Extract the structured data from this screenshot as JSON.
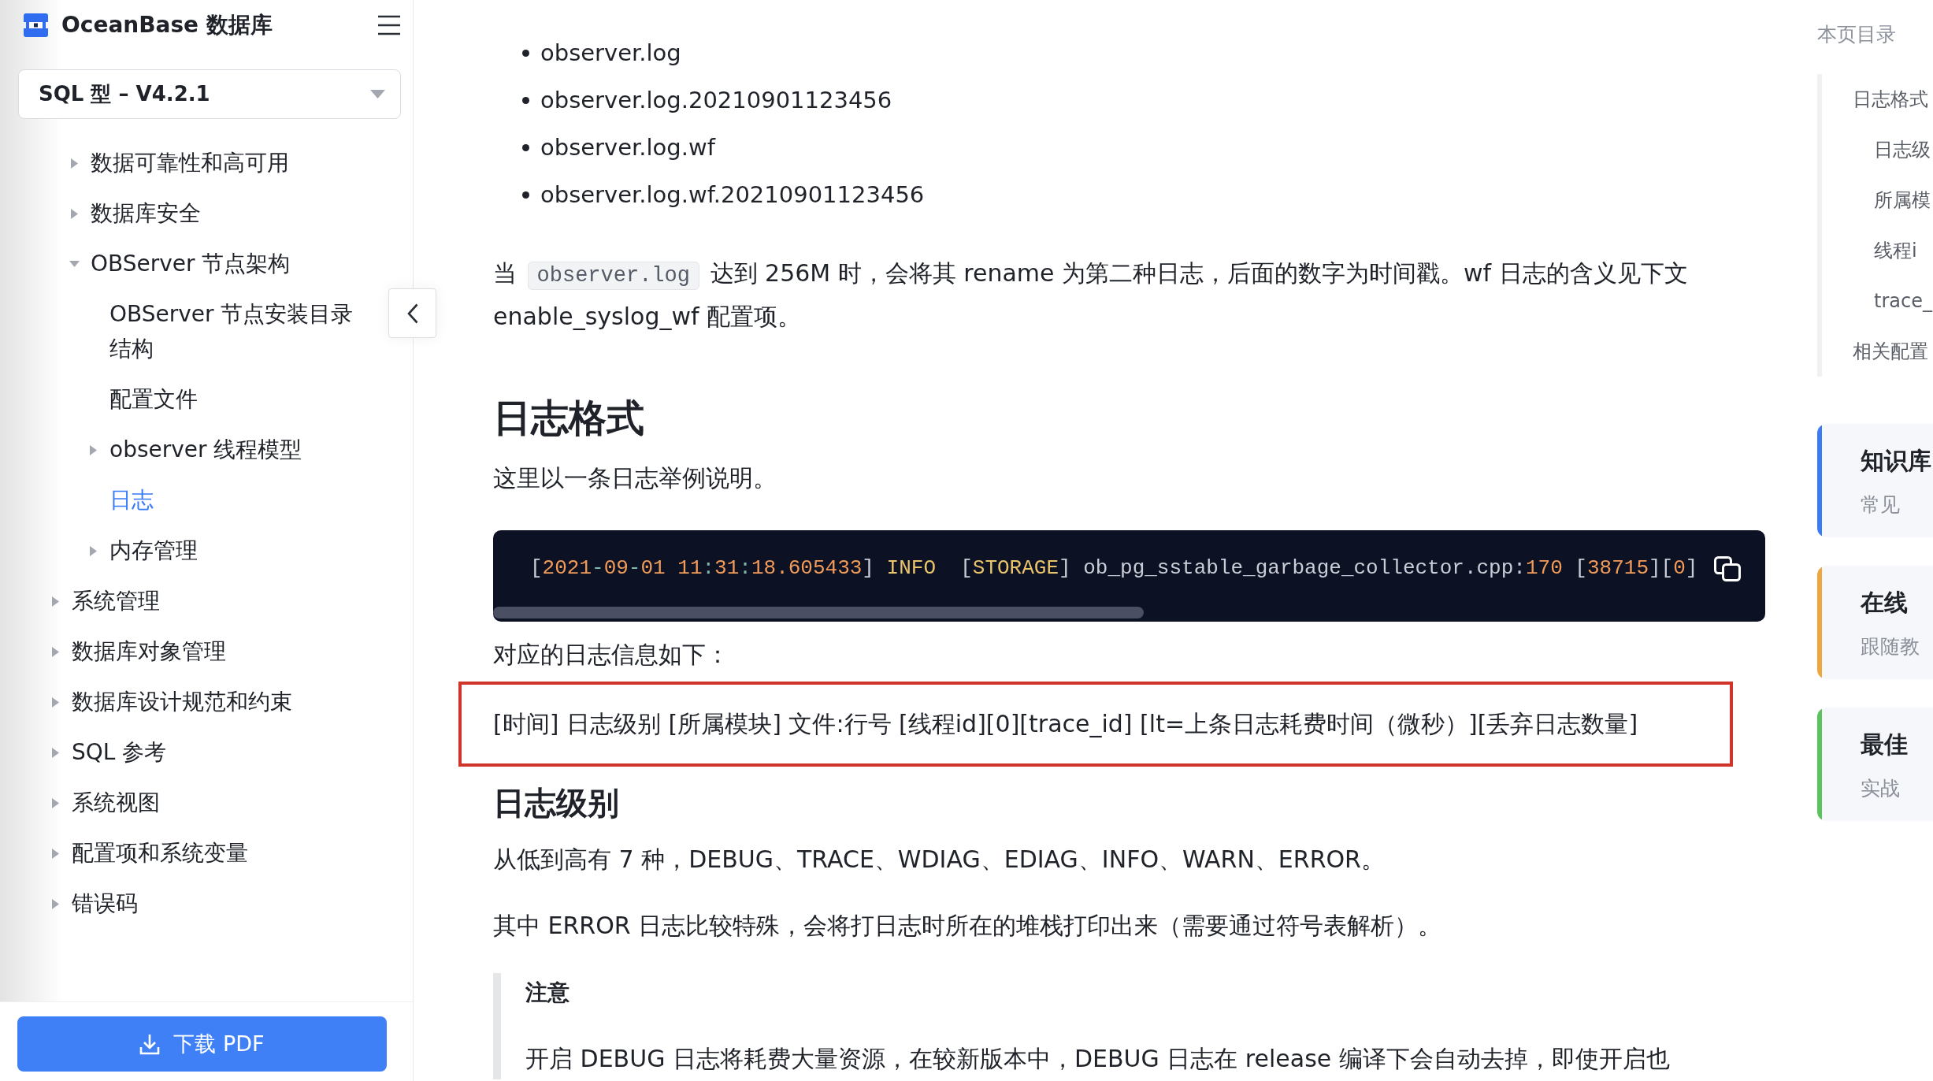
{
  "sidebar": {
    "brand": "OceanBase 数据库",
    "version_select": {
      "value": "SQL 型 – V4.2.1"
    },
    "nav": {
      "branch_continued": [
        {
          "label": "数据可靠性和高可用",
          "expanded": false,
          "selected": false
        },
        {
          "label": "数据库安全",
          "expanded": false,
          "selected": false
        },
        {
          "label": "OBServer 节点架构",
          "expanded": true,
          "selected": false,
          "children": [
            {
              "label": "OBServer 节点安装目录结构",
              "selected": false
            },
            {
              "label": "配置文件",
              "selected": false
            },
            {
              "label": "observer 线程模型",
              "expanded": false,
              "selected": false
            },
            {
              "label": "日志",
              "selected": true
            },
            {
              "label": "内存管理",
              "expanded": false,
              "selected": false
            }
          ]
        }
      ],
      "items": [
        {
          "label": "系统管理",
          "expanded": false,
          "selected": false
        },
        {
          "label": "数据库对象管理",
          "expanded": false,
          "selected": false
        },
        {
          "label": "数据库设计规范和约束",
          "expanded": false,
          "selected": false
        },
        {
          "label": "SQL 参考",
          "expanded": false,
          "selected": false
        },
        {
          "label": "系统视图",
          "expanded": false,
          "selected": false
        },
        {
          "label": "配置项和系统变量",
          "expanded": false,
          "selected": false
        },
        {
          "label": "错误码",
          "expanded": false,
          "selected": false
        }
      ]
    },
    "download_button": {
      "label": "下载 PDF"
    }
  },
  "article": {
    "blocks": [
      {
        "kind": "bullets",
        "items": [
          "observer.log",
          "observer.log.20210901123456",
          "observer.log.wf",
          "observer.log.wf.20210901123456"
        ]
      },
      {
        "kind": "paragraph",
        "segments": [
          {
            "kind": "text",
            "text": "当 "
          },
          {
            "kind": "code",
            "text": "observer.log"
          },
          {
            "kind": "text",
            "text": " 达到 256M 时，会将其 rename 为第二种日志，后面的数字为时间戳。wf 日志的含义见下文 enable_syslog_wf 配置项。"
          }
        ]
      },
      {
        "kind": "h2",
        "text": "日志格式"
      },
      {
        "kind": "paragraph",
        "text": "这里以一条日志举例说明。"
      },
      {
        "kind": "code",
        "tokens": [
          {
            "kind": "plain",
            "text": "["
          },
          {
            "kind": "number",
            "text": "2021"
          },
          {
            "kind": "punct",
            "text": "-"
          },
          {
            "kind": "number",
            "text": "09"
          },
          {
            "kind": "punct",
            "text": "-"
          },
          {
            "kind": "number",
            "text": "01 11"
          },
          {
            "kind": "punct",
            "text": ":"
          },
          {
            "kind": "number",
            "text": "31"
          },
          {
            "kind": "punct",
            "text": ":"
          },
          {
            "kind": "number",
            "text": "18.605433"
          },
          {
            "kind": "plain",
            "text": "] "
          },
          {
            "kind": "keyword",
            "text": "INFO"
          },
          {
            "kind": "plain",
            "text": "  ["
          },
          {
            "kind": "keyword",
            "text": "STORAGE"
          },
          {
            "kind": "plain",
            "text": "] ob_pg_sstable_garbage_collector.cpp:"
          },
          {
            "kind": "number",
            "text": "170"
          },
          {
            "kind": "plain",
            "text": " ["
          },
          {
            "kind": "number",
            "text": "38715"
          },
          {
            "kind": "plain",
            "text": "]["
          },
          {
            "kind": "number",
            "text": "0"
          },
          {
            "kind": "plain",
            "text": "]"
          }
        ]
      },
      {
        "kind": "paragraph",
        "text": "对应的日志信息如下："
      },
      {
        "kind": "highlight",
        "text": "[时间] 日志级别 [所属模块] 文件:行号 [线程id][0][trace_id] [lt=上条日志耗费时间（微秒）][丢弃日志数量]"
      },
      {
        "kind": "h3",
        "text": "日志级别"
      },
      {
        "kind": "paragraph",
        "text": "从低到高有 7 种，DEBUG、TRACE、WDIAG、EDIAG、INFO、WARN、ERROR。"
      },
      {
        "kind": "paragraph",
        "text": "其中 ERROR 日志比较特殊，会将打日志时所在的堆栈打印出来（需要通过符号表解析）。"
      },
      {
        "kind": "note",
        "title": "注意",
        "text": "开启 DEBUG 日志将耗费大量资源，在较新版本中，DEBUG 日志在 release 编译下会自动去掉，即使开启也"
      }
    ]
  },
  "toc": {
    "title": "本页目录",
    "items": [
      {
        "label": "日志格式",
        "children": [
          {
            "label": "日志级"
          },
          {
            "label": "所属模"
          },
          {
            "label": "线程i"
          },
          {
            "label": "trace_"
          }
        ]
      },
      {
        "label": "相关配置"
      }
    ]
  },
  "cards": [
    {
      "title": "知识库",
      "subtitle": "常见",
      "color": "#3b7cf6"
    },
    {
      "title": "在线",
      "subtitle": "跟随教",
      "color": "#eea63f"
    },
    {
      "title": "最佳",
      "subtitle": "实战",
      "color": "#58c45b"
    }
  ]
}
